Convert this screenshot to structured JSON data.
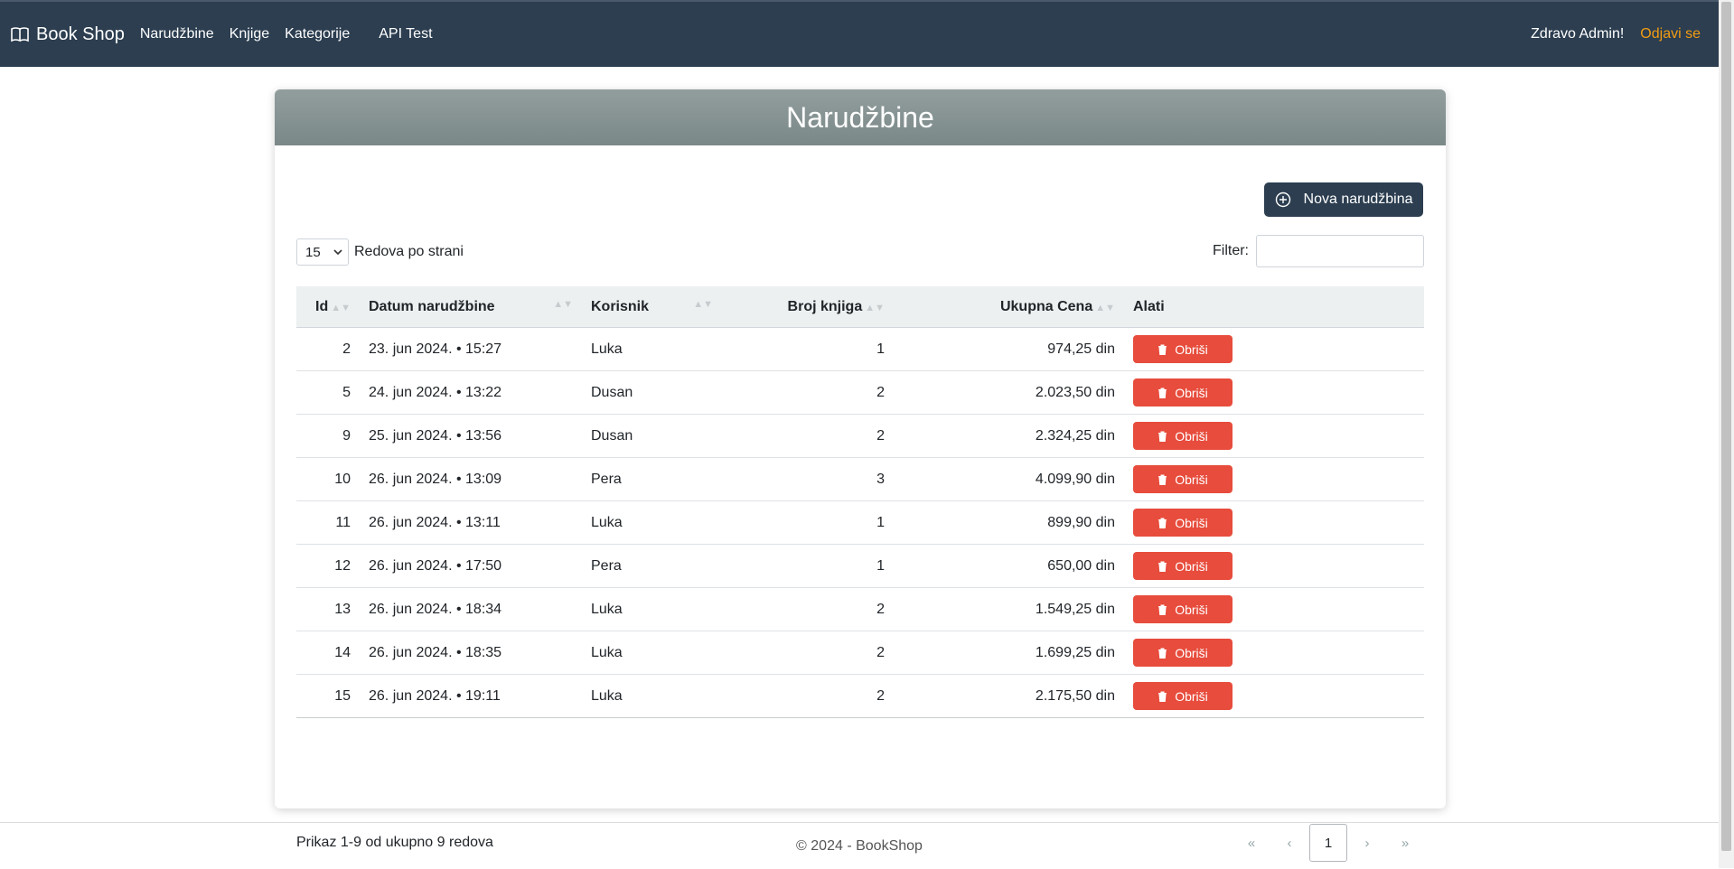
{
  "nav": {
    "brand": "Book Shop",
    "links": [
      "Narudžbine",
      "Knjige",
      "Kategorije",
      "API Test"
    ],
    "greeting": "Zdravo Admin!",
    "logout": "Odjavi se",
    "colors": {
      "navbar": "#2c3e50",
      "logout": "#f39c12"
    }
  },
  "card": {
    "title": "Narudžbine",
    "new_button": "Nova narudžbina"
  },
  "controls": {
    "page_size": "15",
    "page_size_label": "Redova po strani",
    "filter_label": "Filter:",
    "filter_value": ""
  },
  "table": {
    "columns": [
      "Id",
      "Datum narudžbine",
      "Korisnik",
      "Broj knjiga",
      "Ukupna Cena",
      "Alati"
    ],
    "delete_label": "Obriši",
    "rows": [
      {
        "id": "2",
        "date": "23. jun 2024. • 15:27",
        "user": "Luka",
        "count": "1",
        "total": "974,25 din"
      },
      {
        "id": "5",
        "date": "24. jun 2024. • 13:22",
        "user": "Dusan",
        "count": "2",
        "total": "2.023,50 din"
      },
      {
        "id": "9",
        "date": "25. jun 2024. • 13:56",
        "user": "Dusan",
        "count": "2",
        "total": "2.324,25 din"
      },
      {
        "id": "10",
        "date": "26. jun 2024. • 13:09",
        "user": "Pera",
        "count": "3",
        "total": "4.099,90 din"
      },
      {
        "id": "11",
        "date": "26. jun 2024. • 13:11",
        "user": "Luka",
        "count": "1",
        "total": "899,90 din"
      },
      {
        "id": "12",
        "date": "26. jun 2024. • 17:50",
        "user": "Pera",
        "count": "1",
        "total": "650,00 din"
      },
      {
        "id": "13",
        "date": "26. jun 2024. • 18:34",
        "user": "Luka",
        "count": "2",
        "total": "1.549,25 din"
      },
      {
        "id": "14",
        "date": "26. jun 2024. • 18:35",
        "user": "Luka",
        "count": "2",
        "total": "1.699,25 din"
      },
      {
        "id": "15",
        "date": "26. jun 2024. • 19:11",
        "user": "Luka",
        "count": "2",
        "total": "2.175,50 din"
      }
    ]
  },
  "pagination": {
    "summary": "Prikaz 1-9 od ukupno 9 redova",
    "first": "«",
    "prev": "‹",
    "current": "1",
    "next": "›",
    "last": "»"
  },
  "footer": {
    "text": "© 2024 - BookShop"
  },
  "colors": {
    "delete_button": "#e74c3c",
    "header_gradient": "#8a9696"
  }
}
